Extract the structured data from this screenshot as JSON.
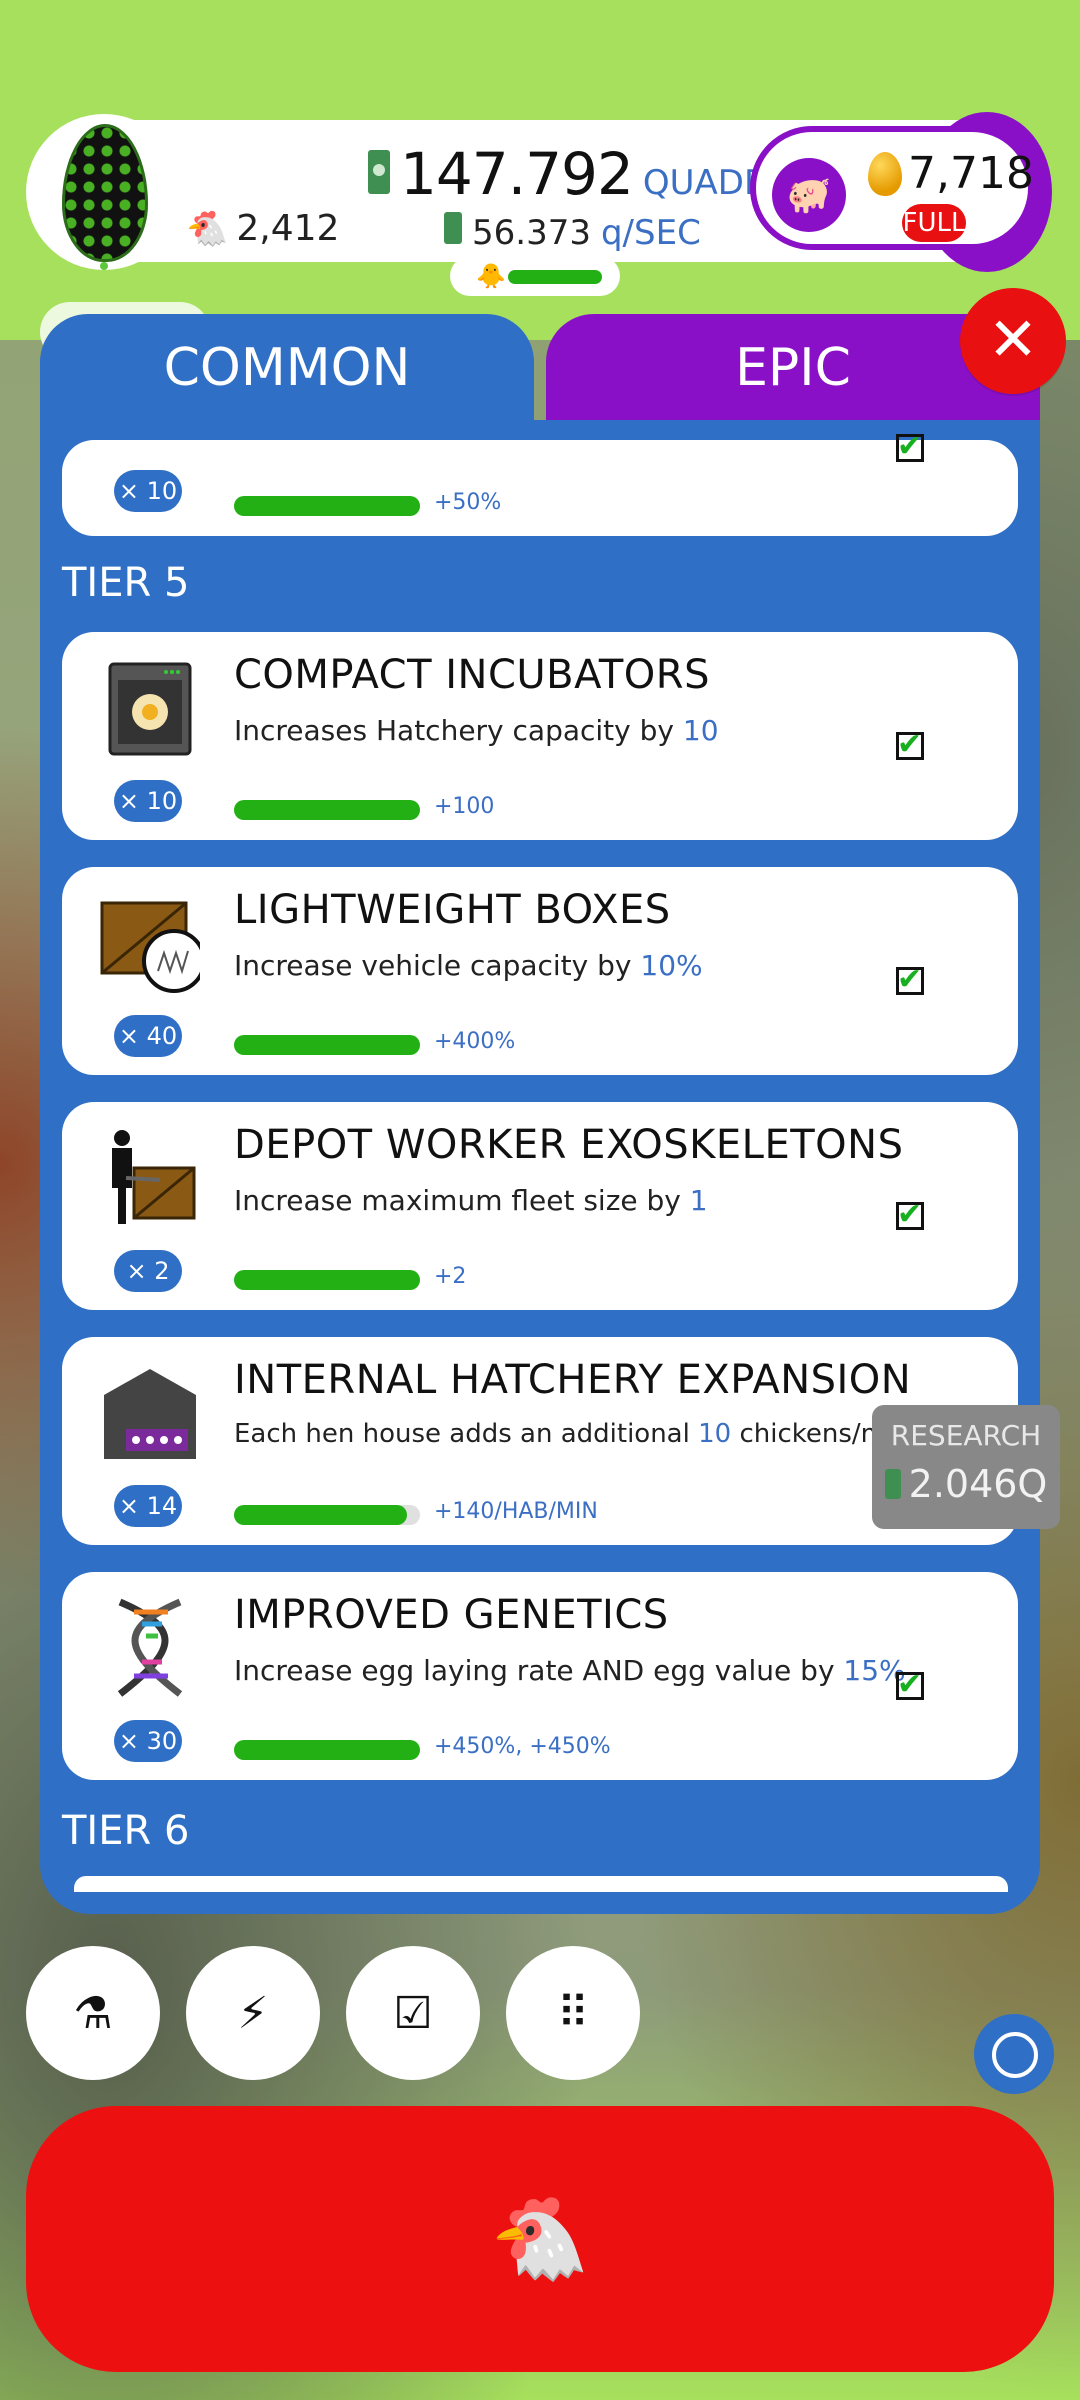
{
  "header": {
    "chicken_count": "2,412",
    "money_value": "147.792",
    "money_unit": "QUADRILLION",
    "rate_value": "56.373",
    "rate_unit": "q/SEC",
    "golden_eggs": "7,718",
    "bank_status": "FULL"
  },
  "tabs": [
    {
      "label": "COMMON",
      "active": true
    },
    {
      "label": "EPIC",
      "active": false
    }
  ],
  "partial_card": {
    "multiplier": "× 10",
    "bonus": "+50%",
    "progress": 1.0
  },
  "tiers": [
    {
      "label": "TIER 5",
      "items": [
        {
          "title": "COMPACT INCUBATORS",
          "desc_pre": "Increases Hatchery capacity by ",
          "desc_hl": "10",
          "desc_post": "",
          "multiplier": "× 10",
          "bonus": "+100",
          "progress": 1.0,
          "icon": "incubator-icon",
          "completed": true
        },
        {
          "title": "LIGHTWEIGHT BOXES",
          "desc_pre": "Increase vehicle capacity by ",
          "desc_hl": "10%",
          "desc_post": "",
          "multiplier": "× 40",
          "bonus": "+400%",
          "progress": 1.0,
          "icon": "box-scale-icon",
          "completed": true
        },
        {
          "title": "DEPOT WORKER EXOSKELETONS",
          "desc_pre": "Increase maximum fleet size by ",
          "desc_hl": "1",
          "desc_post": "",
          "multiplier": "× 2",
          "bonus": "+2",
          "progress": 1.0,
          "icon": "exoskeleton-worker-icon",
          "completed": true
        },
        {
          "title": "INTERNAL HATCHERY EXPANSION",
          "desc_pre": "Each hen house adds an additional ",
          "desc_hl": "10",
          "desc_post": " chickens/min",
          "multiplier": "× 14",
          "bonus": "+140/HAB/MIN",
          "progress": 0.93,
          "icon": "hen-house-icon",
          "completed": false,
          "research_label": "RESEARCH",
          "research_price": "2.046Q"
        },
        {
          "title": "IMPROVED GENETICS",
          "desc_pre": "Increase egg laying rate AND egg value by ",
          "desc_hl": "15%",
          "desc_post": "",
          "multiplier": "× 30",
          "bonus": "+450%, +450%",
          "progress": 1.0,
          "icon": "dna-icon",
          "completed": true
        }
      ]
    },
    {
      "label": "TIER 6",
      "items": []
    }
  ],
  "bottom_nav": [
    {
      "icon": "flask-icon",
      "glyph": "⚗"
    },
    {
      "icon": "lightning-icon",
      "glyph": "⚡"
    },
    {
      "icon": "checklist-icon",
      "glyph": "☑"
    },
    {
      "icon": "grid-menu-icon",
      "glyph": "⠿"
    }
  ],
  "colors": {
    "accent_blue": "#2f6fc6",
    "epic_purple": "#8a10c8",
    "hatch_red": "#ed1010",
    "progress_green": "#22b014",
    "background_green": "#a6e05c"
  }
}
